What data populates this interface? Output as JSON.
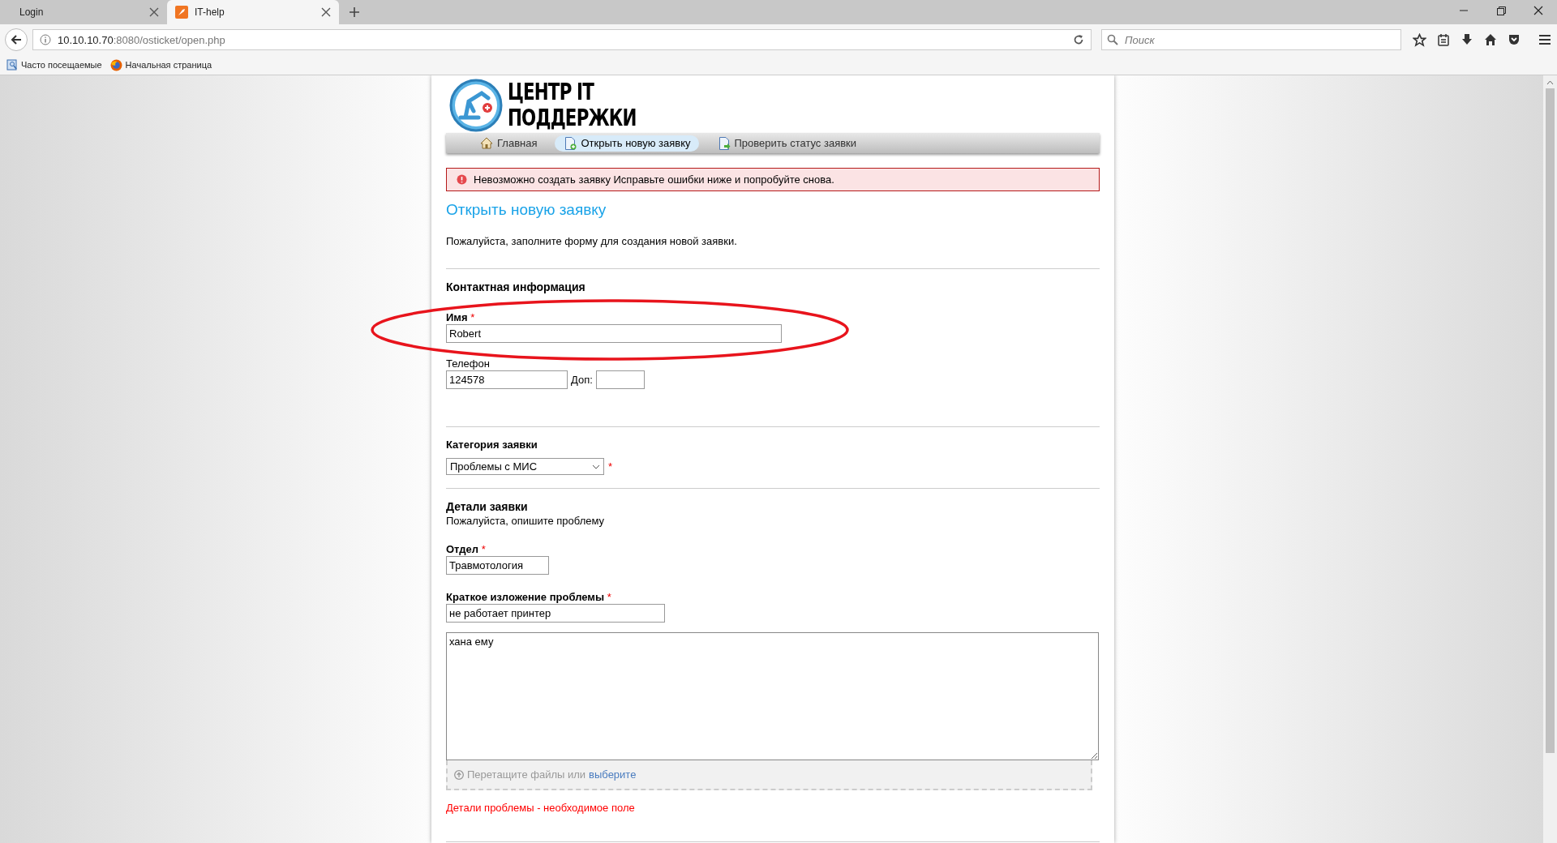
{
  "browser": {
    "tabs": [
      {
        "title": "Login",
        "selected": false
      },
      {
        "title": "IT-help",
        "selected": true
      }
    ],
    "address": {
      "host": "10.10.10.70",
      "path": ":8080/osticket/open.php"
    },
    "search": {
      "placeholder": "Поиск"
    },
    "bookmarks": [
      {
        "label": "Часто посещаемые"
      },
      {
        "label": "Начальная страница"
      }
    ]
  },
  "header": {
    "logo_lines": [
      "ЦЕНТР IT",
      "ПОДДЕРЖКИ"
    ]
  },
  "nav": [
    {
      "label": "Главная",
      "selected": false
    },
    {
      "label": "Открыть новую заявку",
      "selected": true
    },
    {
      "label": "Проверить статус заявки",
      "selected": false
    }
  ],
  "error_banner": "Невозможно создать заявку Исправьте ошибки ниже и попробуйте снова.",
  "title": "Открыть новую заявку",
  "intro": "Пожалуйста, заполните форму для создания новой заявки.",
  "contact": {
    "heading": "Контактная информация",
    "name": {
      "label": "Имя",
      "mark": "*",
      "value": "Robert"
    },
    "phone": {
      "label": "Телефон",
      "value": "124578",
      "ext_label": "Доп:"
    }
  },
  "category": {
    "heading": "Категория заявки",
    "value": "Проблемы с МИС",
    "mark": "*"
  },
  "details": {
    "heading": "Детали заявки",
    "subtitle": "Пожалуйста, опишите проблему",
    "fields": [
      {
        "kind": "text",
        "label": "Отдел",
        "mark": "*",
        "value": "Травмотология"
      },
      {
        "kind": "text",
        "label": "Краткое изложение проблемы",
        "mark": "*",
        "value": "не работает принтер"
      },
      {
        "kind": "textarea",
        "value": "хана ему"
      }
    ],
    "dropzone": {
      "text": "Перетащите файлы или",
      "link": "выберите"
    },
    "error": "Детали проблемы - необходимое поле"
  },
  "annotation": {
    "kind": "ellipse"
  }
}
